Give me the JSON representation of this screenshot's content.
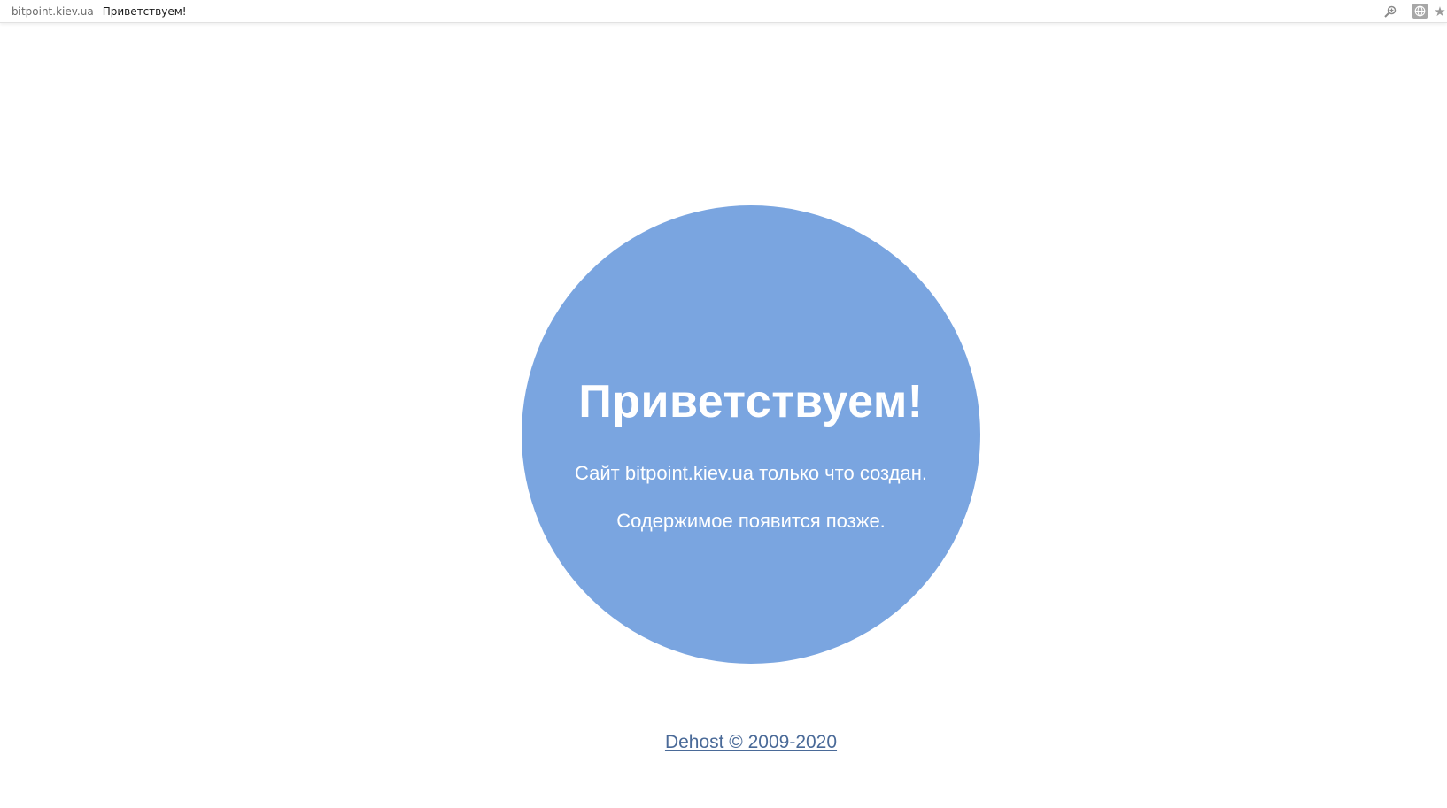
{
  "browser": {
    "url_domain": "bitpoint.kiev.ua",
    "tab_title": "Приветствуем!",
    "icons": [
      "zoom-icon",
      "globe-icon",
      "star-icon"
    ]
  },
  "page": {
    "heading": "Приветствуем!",
    "site_created": "Сайт bitpoint.kiev.ua только что создан.",
    "content_later": "Содержимое появится позже.",
    "footer_link": "Dehost © 2009-2020"
  },
  "colors": {
    "circle": "#7aa5e0",
    "text": "#ffffff",
    "link": "#4a6a98"
  }
}
